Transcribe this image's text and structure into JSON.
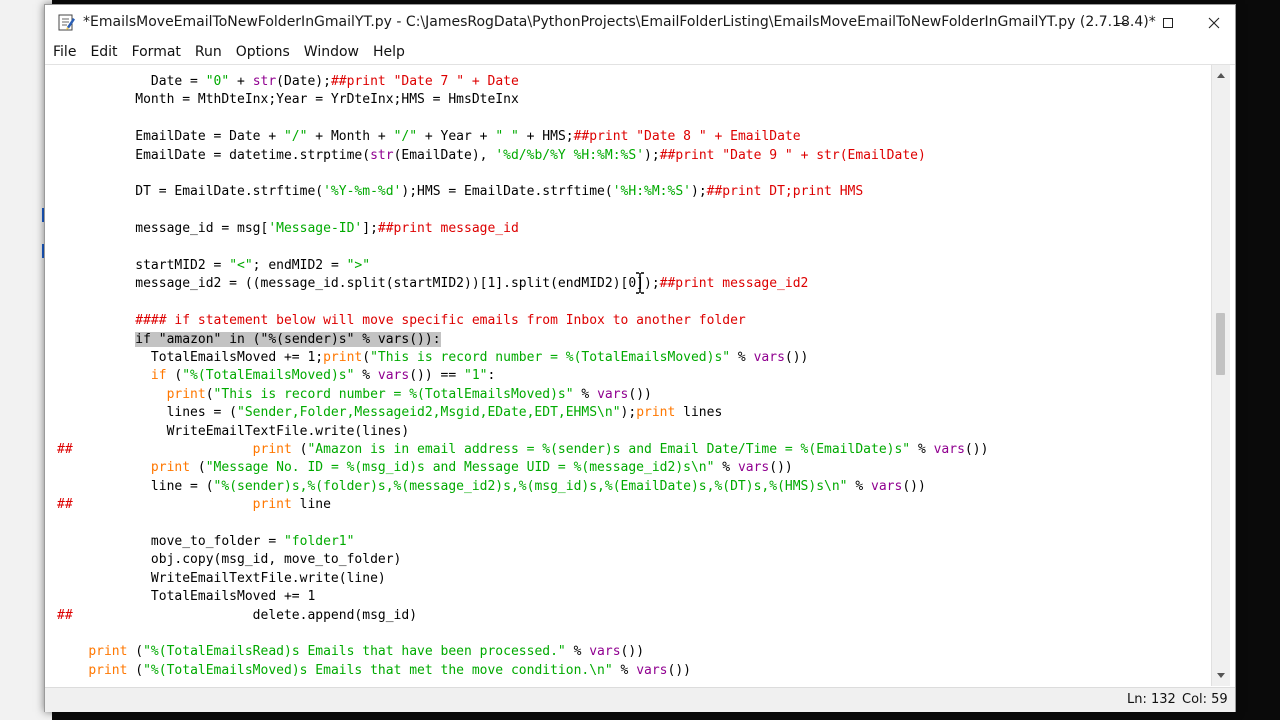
{
  "window": {
    "title": "*EmailsMoveEmailToNewFolderInGmailYT.py - C:\\JamesRogData\\PythonProjects\\EmailFolderListing\\EmailsMoveEmailToNewFolderInGmailYT.py (2.7.18.4)*",
    "controls": {
      "minimize_icon": "minimize-icon",
      "maximize_icon": "maximize-icon",
      "close_icon": "close-icon"
    }
  },
  "menu": [
    "File",
    "Edit",
    "Format",
    "Run",
    "Options",
    "Window",
    "Help"
  ],
  "colors": {
    "keyword": "#ff7700",
    "builtin": "#900090",
    "string": "#00aa00",
    "comment": "#dd0000",
    "selection": "#c3c3c3"
  },
  "code_lines": [
    [
      {
        "t": "            Date = "
      },
      {
        "t": "\"0\"",
        "c": "str"
      },
      {
        "t": " + "
      },
      {
        "t": "str",
        "c": "bi"
      },
      {
        "t": "(Date);"
      },
      {
        "t": "##print \"Date 7 \" + Date",
        "c": "cmt"
      }
    ],
    [
      {
        "t": "          Month = MthDteInx;Year = YrDteInx;HMS = HmsDteInx"
      }
    ],
    [
      {
        "t": ""
      }
    ],
    [
      {
        "t": "          EmailDate = Date + "
      },
      {
        "t": "\"/\"",
        "c": "str"
      },
      {
        "t": " + Month + "
      },
      {
        "t": "\"/\"",
        "c": "str"
      },
      {
        "t": " + Year + "
      },
      {
        "t": "\" \"",
        "c": "str"
      },
      {
        "t": " + HMS;"
      },
      {
        "t": "##print \"Date 8 \" + EmailDate",
        "c": "cmt"
      }
    ],
    [
      {
        "t": "          EmailDate = datetime.strptime("
      },
      {
        "t": "str",
        "c": "bi"
      },
      {
        "t": "(EmailDate), "
      },
      {
        "t": "'%d/%b/%Y %H:%M:%S'",
        "c": "str"
      },
      {
        "t": ");"
      },
      {
        "t": "##print \"Date 9 \" + str(EmailDate)",
        "c": "cmt"
      }
    ],
    [
      {
        "t": ""
      }
    ],
    [
      {
        "t": "          DT = EmailDate.strftime("
      },
      {
        "t": "'%Y-%m-%d'",
        "c": "str"
      },
      {
        "t": ");HMS = EmailDate.strftime("
      },
      {
        "t": "'%H:%M:%S'",
        "c": "str"
      },
      {
        "t": ");"
      },
      {
        "t": "##print DT;print HMS",
        "c": "cmt"
      }
    ],
    [
      {
        "t": ""
      }
    ],
    [
      {
        "t": "          message_id = msg["
      },
      {
        "t": "'Message-ID'",
        "c": "str"
      },
      {
        "t": "];"
      },
      {
        "t": "##print message_id",
        "c": "cmt"
      }
    ],
    [
      {
        "t": ""
      }
    ],
    [
      {
        "t": "          startMID2 = "
      },
      {
        "t": "\"<\"",
        "c": "str"
      },
      {
        "t": "; endMID2 = "
      },
      {
        "t": "\">\"",
        "c": "str"
      }
    ],
    [
      {
        "t": "          message_id2 = ((message_id.split(startMID2))[1].split(endMID2)[0]);"
      },
      {
        "t": "##print message_id2",
        "c": "cmt"
      }
    ],
    [
      {
        "t": ""
      }
    ],
    [
      {
        "t": "          #### if statement below will move specific emails from Inbox to another folder",
        "c": "cmt"
      }
    ],
    [
      {
        "t": "          "
      },
      {
        "t": "if \"amazon\" in (\"%(sender)s\" % vars()):",
        "c": "sel"
      }
    ],
    [
      {
        "t": "            TotalEmailsMoved += 1;"
      },
      {
        "t": "print",
        "c": "kw"
      },
      {
        "t": "("
      },
      {
        "t": "\"This is record number = %(TotalEmailsMoved)s\"",
        "c": "str"
      },
      {
        "t": " % "
      },
      {
        "t": "vars",
        "c": "bi"
      },
      {
        "t": "())"
      }
    ],
    [
      {
        "t": "            "
      },
      {
        "t": "if",
        "c": "kw"
      },
      {
        "t": " ("
      },
      {
        "t": "\"%(TotalEmailsMoved)s\"",
        "c": "str"
      },
      {
        "t": " % "
      },
      {
        "t": "vars",
        "c": "bi"
      },
      {
        "t": "()) == "
      },
      {
        "t": "\"1\"",
        "c": "str"
      },
      {
        "t": ":"
      }
    ],
    [
      {
        "t": "              "
      },
      {
        "t": "print",
        "c": "kw"
      },
      {
        "t": "("
      },
      {
        "t": "\"This is record number = %(TotalEmailsMoved)s\"",
        "c": "str"
      },
      {
        "t": " % "
      },
      {
        "t": "vars",
        "c": "bi"
      },
      {
        "t": "())"
      }
    ],
    [
      {
        "t": "              lines = ("
      },
      {
        "t": "\"Sender,Folder,Messageid2,Msgid,EDate,EDT,EHMS\\n\"",
        "c": "str"
      },
      {
        "t": ");"
      },
      {
        "t": "print",
        "c": "kw"
      },
      {
        "t": " lines"
      }
    ],
    [
      {
        "t": "              WriteEmailTextFile.write(lines)"
      }
    ],
    [
      {
        "t": "##",
        "c": "cmt"
      },
      {
        "t": "                       "
      },
      {
        "t": "print",
        "c": "kw"
      },
      {
        "t": " ("
      },
      {
        "t": "\"Amazon is in email address = %(sender)s and Email Date/Time = %(EmailDate)s\"",
        "c": "str"
      },
      {
        "t": " % "
      },
      {
        "t": "vars",
        "c": "bi"
      },
      {
        "t": "())"
      }
    ],
    [
      {
        "t": "            "
      },
      {
        "t": "print",
        "c": "kw"
      },
      {
        "t": " ("
      },
      {
        "t": "\"Message No. ID = %(msg_id)s and Message UID = %(message_id2)s\\n\"",
        "c": "str"
      },
      {
        "t": " % "
      },
      {
        "t": "vars",
        "c": "bi"
      },
      {
        "t": "())"
      }
    ],
    [
      {
        "t": "            line = ("
      },
      {
        "t": "\"%(sender)s,%(folder)s,%(message_id2)s,%(msg_id)s,%(EmailDate)s,%(DT)s,%(HMS)s\\n\"",
        "c": "str"
      },
      {
        "t": " % "
      },
      {
        "t": "vars",
        "c": "bi"
      },
      {
        "t": "())"
      }
    ],
    [
      {
        "t": "##",
        "c": "cmt"
      },
      {
        "t": "                       "
      },
      {
        "t": "print",
        "c": "kw"
      },
      {
        "t": " line"
      }
    ],
    [
      {
        "t": ""
      }
    ],
    [
      {
        "t": "            move_to_folder = "
      },
      {
        "t": "\"folder1\"",
        "c": "str"
      }
    ],
    [
      {
        "t": "            obj.copy(msg_id, move_to_folder)"
      }
    ],
    [
      {
        "t": "            WriteEmailTextFile.write(line)"
      }
    ],
    [
      {
        "t": "            TotalEmailsMoved += 1"
      }
    ],
    [
      {
        "t": "##",
        "c": "cmt"
      },
      {
        "t": "                       delete.append(msg_id)"
      }
    ],
    [
      {
        "t": ""
      }
    ],
    [
      {
        "t": "    "
      },
      {
        "t": "print",
        "c": "kw"
      },
      {
        "t": " ("
      },
      {
        "t": "\"%(TotalEmailsRead)s Emails that have been processed.\"",
        "c": "str"
      },
      {
        "t": " % "
      },
      {
        "t": "vars",
        "c": "bi"
      },
      {
        "t": "())"
      }
    ],
    [
      {
        "t": "    "
      },
      {
        "t": "print",
        "c": "kw"
      },
      {
        "t": " ("
      },
      {
        "t": "\"%(TotalEmailsMoved)s Emails that met the move condition.\\n\"",
        "c": "str"
      },
      {
        "t": " % "
      },
      {
        "t": "vars",
        "c": "bi"
      },
      {
        "t": "())"
      }
    ]
  ],
  "status": {
    "line": "Ln: 132",
    "col": "Col: 59"
  }
}
